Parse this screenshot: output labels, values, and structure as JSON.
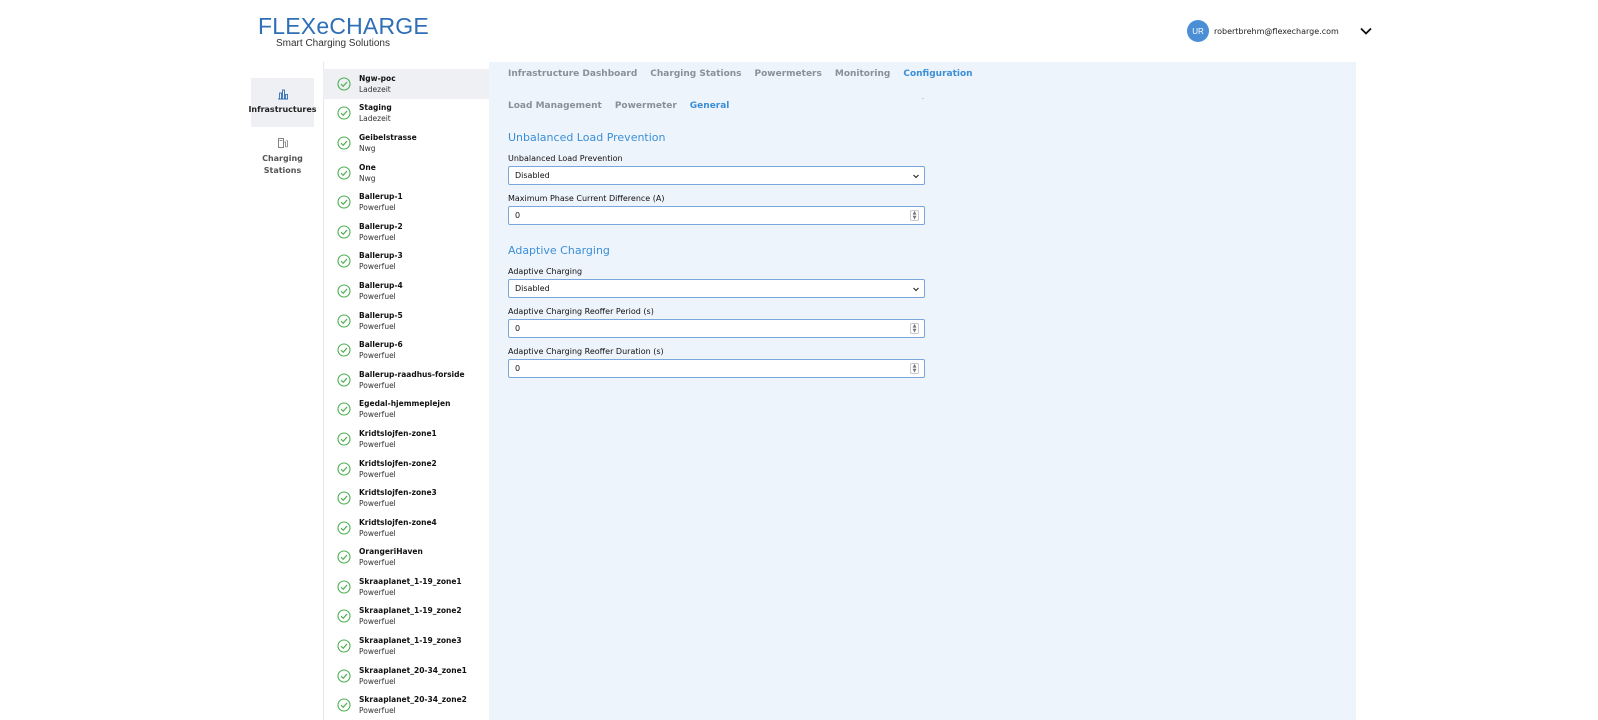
{
  "header": {
    "logo_main": "FLEXeCHARGE",
    "logo_sub": "Smart Charging Solutions",
    "user_initials": "UR",
    "user_email": "robertbrehm@flexecharge.com"
  },
  "nav": {
    "items": [
      {
        "label": "Infrastructures",
        "icon": "bar-chart-icon",
        "active": true
      },
      {
        "label": "Charging Stations",
        "icon": "charging-station-icon",
        "active": false
      }
    ]
  },
  "infrastructures": [
    {
      "name": "Ngw-poc",
      "sub": "Ladezeit"
    },
    {
      "name": "Staging",
      "sub": "Ladezeit"
    },
    {
      "name": "Geibelstrasse",
      "sub": "Nwg"
    },
    {
      "name": "One",
      "sub": "Nwg"
    },
    {
      "name": "Ballerup-1",
      "sub": "Powerfuel"
    },
    {
      "name": "Ballerup-2",
      "sub": "Powerfuel"
    },
    {
      "name": "Ballerup-3",
      "sub": "Powerfuel"
    },
    {
      "name": "Ballerup-4",
      "sub": "Powerfuel"
    },
    {
      "name": "Ballerup-5",
      "sub": "Powerfuel"
    },
    {
      "name": "Ballerup-6",
      "sub": "Powerfuel"
    },
    {
      "name": "Ballerup-raadhus-forside",
      "sub": "Powerfuel"
    },
    {
      "name": "Egedal-hjemmeplejen",
      "sub": "Powerfuel"
    },
    {
      "name": "Kridtslojfen-zone1",
      "sub": "Powerfuel"
    },
    {
      "name": "Kridtslojfen-zone2",
      "sub": "Powerfuel"
    },
    {
      "name": "Kridtslojfen-zone3",
      "sub": "Powerfuel"
    },
    {
      "name": "Kridtslojfen-zone4",
      "sub": "Powerfuel"
    },
    {
      "name": "OrangeriHaven",
      "sub": "Powerfuel"
    },
    {
      "name": "Skraaplanet_1-19_zone1",
      "sub": "Powerfuel"
    },
    {
      "name": "Skraaplanet_1-19_zone2",
      "sub": "Powerfuel"
    },
    {
      "name": "Skraaplanet_1-19_zone3",
      "sub": "Powerfuel"
    },
    {
      "name": "Skraaplanet_20-34_zone1",
      "sub": "Powerfuel"
    },
    {
      "name": "Skraaplanet_20-34_zone2",
      "sub": "Powerfuel"
    }
  ],
  "tabs": [
    {
      "label": "Infrastructure Dashboard",
      "active": false
    },
    {
      "label": "Charging Stations",
      "active": false
    },
    {
      "label": "Powermeters",
      "active": false
    },
    {
      "label": "Monitoring",
      "active": false
    },
    {
      "label": "Configuration",
      "active": true
    }
  ],
  "subtabs": [
    {
      "label": "Load Management",
      "active": false
    },
    {
      "label": "Powermeter",
      "active": false
    },
    {
      "label": "General",
      "active": true
    }
  ],
  "unbalanced": {
    "title": "Unbalanced Load Prevention",
    "select_label": "Unbalanced Load Prevention",
    "select_value": "Disabled",
    "diff_label": "Maximum Phase Current Difference (A)",
    "diff_value": "0"
  },
  "adaptive": {
    "title": "Adaptive Charging",
    "select_label": "Adaptive Charging",
    "select_value": "Disabled",
    "period_label": "Adaptive Charging Reoffer Period (s)",
    "period_value": "0",
    "duration_label": "Adaptive Charging Reoffer Duration (s)",
    "duration_value": "0"
  },
  "colors": {
    "accent": "#3b8fd6",
    "check": "#4caf50",
    "panel_bg": "#eef4fc"
  }
}
